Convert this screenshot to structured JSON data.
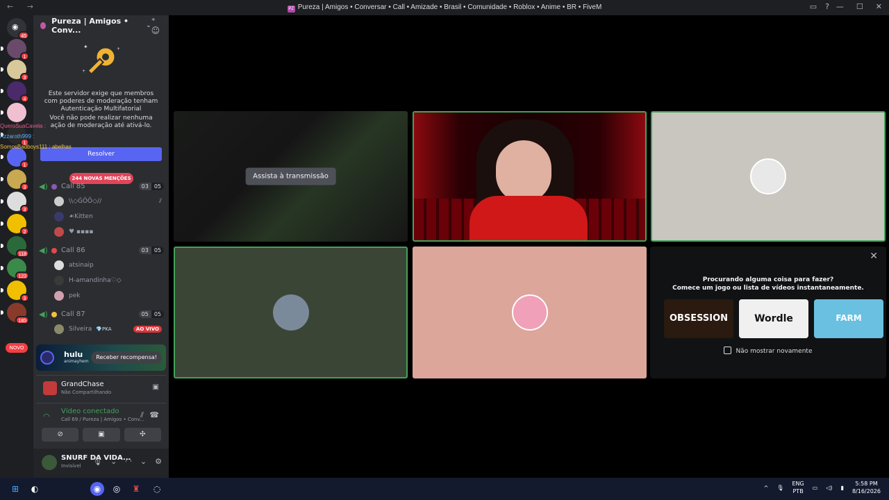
{
  "window": {
    "title": "Pureza | Amigos • Conversar • Call • Amizade • Brasil • Comunidade • Roblox • Anime • BR • FiveM",
    "nav": "← →",
    "app_icon": "PZ"
  },
  "servers": {
    "home_badge": "45",
    "items": [
      {
        "badge": "1",
        "color": "#6a4a6a"
      },
      {
        "badge": "3",
        "color": "#d8c89a"
      },
      {
        "badge": "4",
        "color": "#4a2a6a"
      },
      {
        "badge": "",
        "color": "#f0c0d0"
      },
      {
        "badge": "1",
        "color": "#2a2a2a"
      },
      {
        "badge": "1",
        "color": "#5865f2"
      },
      {
        "badge": "3",
        "color": "#c8a850"
      },
      {
        "badge": "3",
        "color": "#dddddd"
      },
      {
        "badge": "2",
        "color": "#f0c000"
      },
      {
        "badge": "118",
        "color": "#2a6a3a"
      },
      {
        "badge": "123",
        "color": "#3a8a4a"
      },
      {
        "badge": "3",
        "color": "#f0c000"
      },
      {
        "badge": "185",
        "color": "#8a3a2a"
      }
    ],
    "novo": "NOVO"
  },
  "overlay_names": [
    {
      "text": "QueroSuaCavela : ",
      "color": "#e85a8a"
    },
    {
      "text": "Azzaroth999 : ",
      "color": "#5ab0ff"
    },
    {
      "text": "SomosBadboys111 : abelhas",
      "color": "#f0c040"
    }
  ],
  "channel_sidebar": {
    "server_name": "Pureza | Amigos • Conv...",
    "mfa_line1": "Este servidor exige que membros com poderes de moderação tenham Autenticação Multifatorial",
    "mfa_line2": "Você não pode realizar nenhuma ação de moderação até ativá-lo.",
    "resolve_button": "Resolver",
    "mentions_pill": "244 NOVAS MENÇÕES"
  },
  "voice_channels": [
    {
      "name": "Call 85",
      "count_a": "03",
      "count_b": "05",
      "icon_color": "#8a5ab0",
      "users": [
        {
          "name": "\\\\◇ĠÖÕ◇//",
          "tag": "",
          "live": "",
          "avatar": "#cccccc"
        },
        {
          "name": "☙Kitten",
          "tag": "",
          "live": "",
          "avatar": "#3a3a6a"
        },
        {
          "name": "♥ ▪▪▪▪",
          "tag": "",
          "live": "",
          "avatar": "#c04a4a"
        }
      ]
    },
    {
      "name": "Call 86",
      "count_a": "03",
      "count_b": "05",
      "icon_color": "#e04a4a",
      "users": [
        {
          "name": "atsinaip",
          "tag": "",
          "live": "",
          "avatar": "#dddddd"
        },
        {
          "name": "H-amandinha♡◇",
          "tag": "",
          "live": "",
          "avatar": "#3a3a3a"
        },
        {
          "name": "pek",
          "tag": "",
          "live": "",
          "avatar": "#d0a0b0"
        }
      ]
    },
    {
      "name": "Call 87",
      "count_a": "05",
      "count_b": "05",
      "icon_color": "#f0c040",
      "users": [
        {
          "name": "Silveira",
          "tag": "💎PKA",
          "live": "AO VIVO",
          "avatar": "#8a8a6a"
        }
      ]
    }
  ],
  "promo": {
    "brand": "hulu",
    "sub": "animayhem",
    "button": "Receber recompensa!"
  },
  "activity_status": {
    "game": "GrandChase",
    "state": "Não Compartilhando"
  },
  "voice_connection": {
    "title": "Vídeo conectado",
    "subtitle": "Call 69 / Pureza | Amigos • Conv..."
  },
  "user_panel": {
    "name": "SNURF DA VIDA...",
    "status": "Invisível"
  },
  "stage": {
    "watch_button": "Assista à transmissão",
    "activity_title": "Procurando alguma coisa para fazer?",
    "activity_sub": "Comece um jogo ou lista de vídeos instantaneamente.",
    "cards": [
      {
        "label": "OBSESSION",
        "bg": "#2a1a10",
        "fg": "#ffffff"
      },
      {
        "label": "Wordle",
        "bg": "#f0f0f0",
        "fg": "#111111"
      },
      {
        "label": "FARM",
        "bg": "#6ac0e0",
        "fg": "#ffffff"
      }
    ],
    "dont_show": "Não mostrar novamente"
  },
  "taskbar": {
    "lang1": "ENG",
    "lang2": "PTB",
    "time": "5:58 PM",
    "date": "8/16/2026",
    "tray_up": "^"
  },
  "colors": {
    "accent": "#5865f2",
    "speaking": "#43a25a",
    "danger": "#f23f43"
  }
}
